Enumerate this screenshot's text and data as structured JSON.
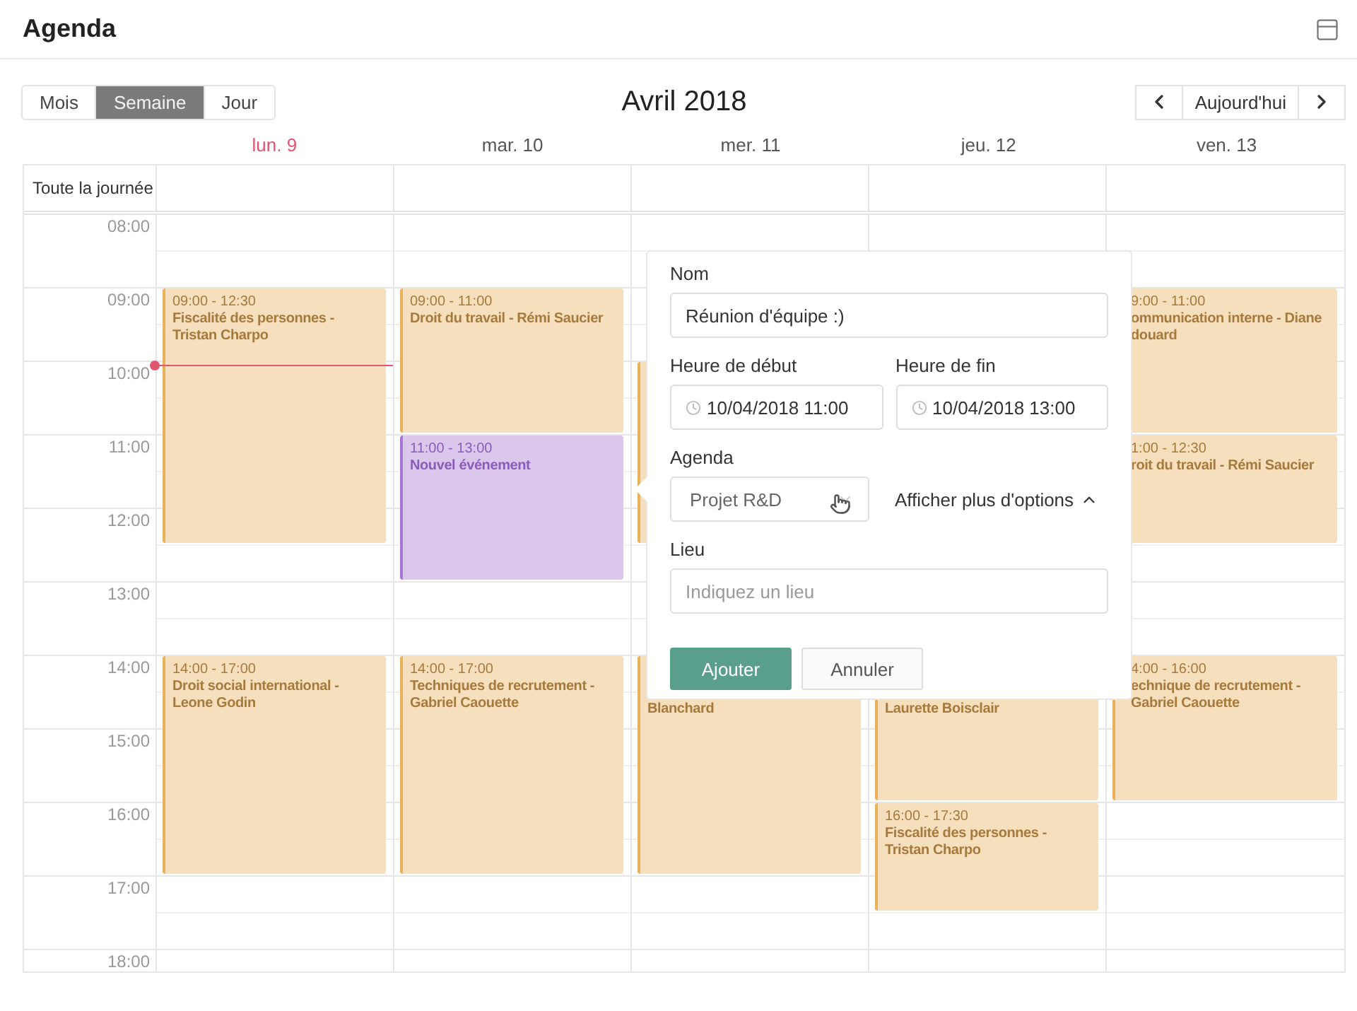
{
  "header": {
    "title": "Agenda"
  },
  "views": [
    {
      "label": "Mois",
      "selected": false
    },
    {
      "label": "Semaine",
      "selected": true
    },
    {
      "label": "Jour",
      "selected": false
    }
  ],
  "month": "Avril 2018",
  "today_button": "Aujourd'hui",
  "all_day_label": "Toute la journée",
  "hours": [
    "08:00",
    "09:00",
    "10:00",
    "11:00",
    "12:00",
    "13:00",
    "14:00",
    "15:00",
    "16:00",
    "17:00",
    "18:00"
  ],
  "days": [
    {
      "label": "lun. 9",
      "today": true,
      "current_time_line": true,
      "events": [
        {
          "kind": "existing",
          "time": "09:00 - 12:30",
          "title": "Fiscalité des personnes -\nTristan Charpo"
        },
        {
          "kind": "existing",
          "time": "14:00 - 17:00",
          "title": "Droit social international -\nLeone Godin"
        }
      ]
    },
    {
      "label": "mar. 10",
      "today": false,
      "current_time_line": false,
      "events": [
        {
          "kind": "existing",
          "time": "09:00 - 11:00",
          "title": "Droit du travail - Rémi Saucier"
        },
        {
          "kind": "draft",
          "time": "11:00 - 13:00",
          "title": "Nouvel événement"
        },
        {
          "kind": "existing",
          "time": "14:00 - 17:00",
          "title": "Techniques de recrutement -\nGabriel Caouette"
        }
      ]
    },
    {
      "label": "mer. 11",
      "today": false,
      "current_time_line": false,
      "events": [
        {
          "kind": "existing"
        },
        {
          "kind": "existing",
          "title": "Blanchard"
        }
      ]
    },
    {
      "label": "jeu. 12",
      "today": false,
      "current_time_line": false,
      "events": [
        {
          "kind": "existing",
          "title": "Laurette Boisclair"
        },
        {
          "kind": "existing",
          "time": "16:00 - 17:30",
          "title": "Fiscalité des personnes -\nTristan Charpo"
        }
      ]
    },
    {
      "label": "ven. 13",
      "today": false,
      "current_time_line": false,
      "events": [
        {
          "kind": "existing",
          "time": "9:00 - 11:00",
          "title": "ommunication interne - Diane\ndouard"
        },
        {
          "kind": "existing",
          "time": "1:00 - 12:30",
          "title": "roit du travail - Rémi Saucier"
        },
        {
          "kind": "existing",
          "time": "4:00 - 16:00",
          "title": "echnique de recrutement -\nGabriel Caouette"
        }
      ]
    }
  ],
  "popup": {
    "name_label": "Nom",
    "name_value": "Réunion d'équipe :)",
    "start_label": "Heure de début",
    "start_value": "10/04/2018 11:00",
    "end_label": "Heure de fin",
    "end_value": "10/04/2018 13:00",
    "agenda_label": "Agenda",
    "agenda_value": "Projet R&D",
    "more_options": "Afficher plus d'options",
    "place_label": "Lieu",
    "place_placeholder": "Indiquez un lieu",
    "buttons": [
      {
        "label": "Ajouter",
        "kind": "primary"
      },
      {
        "label": "Annuler",
        "kind": "secondary"
      }
    ]
  }
}
